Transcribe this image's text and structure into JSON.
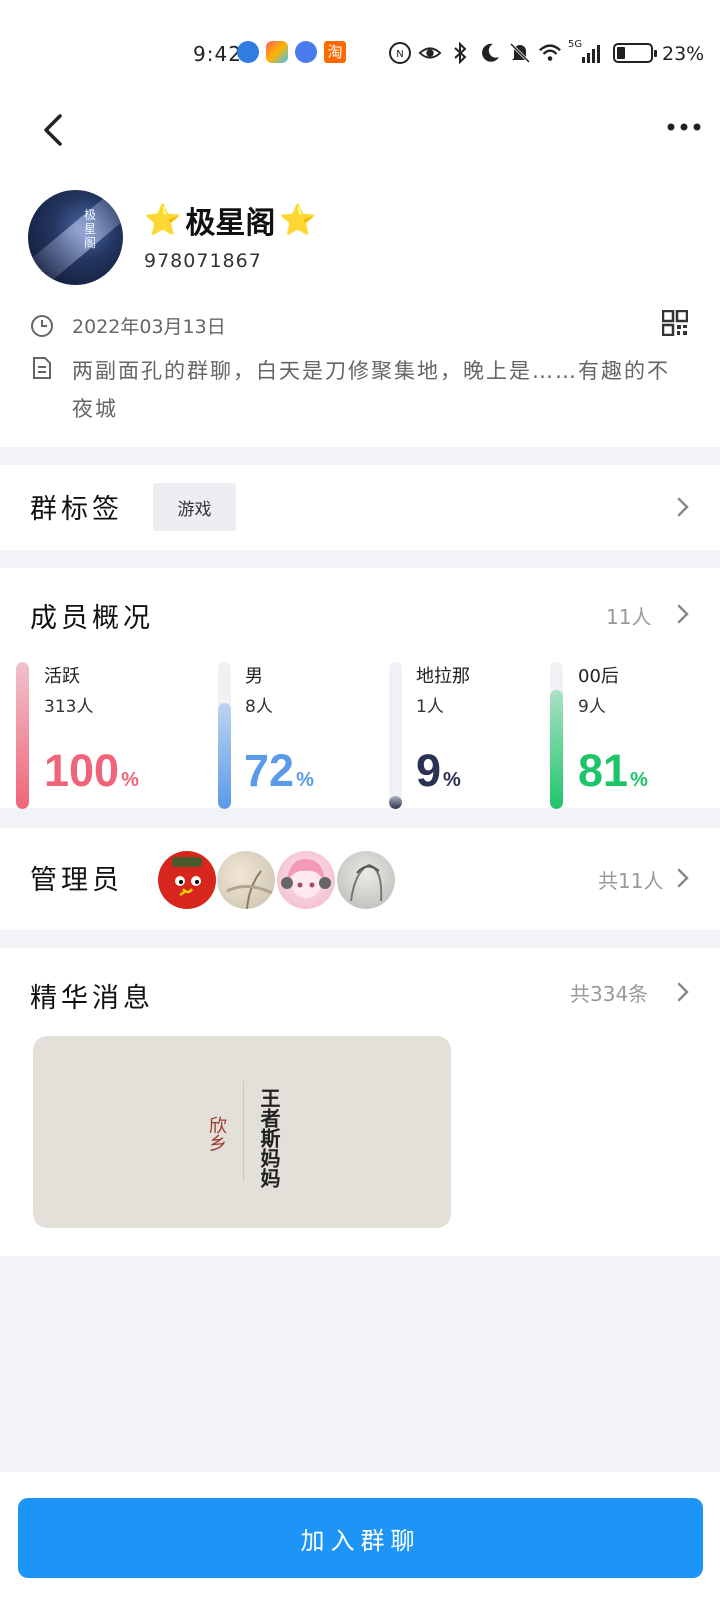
{
  "status_bar": {
    "time": "9:42",
    "network": "5G",
    "battery": "23%"
  },
  "header": {
    "star_left": "⭐",
    "group_name": "极星阁",
    "star_right": "⭐",
    "group_id": "978071867",
    "avatar_text": "极星阁",
    "created_date": "2022年03月13日",
    "description": "两副面孔的群聊，白天是刀修聚集地，晚上是……有趣的不夜城"
  },
  "tags": {
    "title": "群标签",
    "items": [
      "游戏"
    ]
  },
  "members": {
    "title": "成员概况",
    "count": "11人",
    "stats": [
      {
        "label": "活跃",
        "sub": "313人",
        "percent": 100,
        "pct_text": "100",
        "color": "#f0647a"
      },
      {
        "label": "男",
        "sub": "8人",
        "percent": 72,
        "pct_text": "72",
        "color": "#5a9ae8"
      },
      {
        "label": "地拉那",
        "sub": "1人",
        "percent": 9,
        "pct_text": "9",
        "color": "#2b3352"
      },
      {
        "label": "00后",
        "sub": "9人",
        "percent": 81,
        "pct_text": "81",
        "color": "#1ec46a"
      }
    ],
    "pct_sign": "%"
  },
  "admins": {
    "title": "管理员",
    "count": "共11人"
  },
  "essence": {
    "title": "精华消息",
    "count": "共334条",
    "image_text_left": "欣乡",
    "image_text_right": "王者斯妈妈"
  },
  "footer": {
    "join_label": "加入群聊"
  },
  "colors": {
    "accent": "#1d95f6"
  }
}
